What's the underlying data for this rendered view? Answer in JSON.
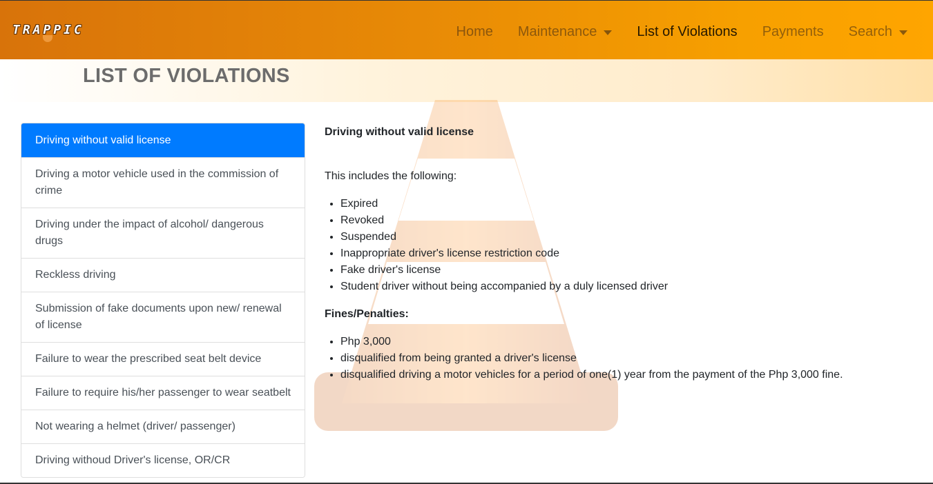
{
  "navbar": {
    "brand": "TRAPPIC",
    "items": [
      {
        "label": "Home",
        "dropdown": false,
        "active": false
      },
      {
        "label": "Maintenance",
        "dropdown": true,
        "active": false
      },
      {
        "label": "List of Violations",
        "dropdown": false,
        "active": true
      },
      {
        "label": "Payments",
        "dropdown": false,
        "active": false
      },
      {
        "label": "Search",
        "dropdown": true,
        "active": false
      }
    ]
  },
  "page": {
    "title": "LIST OF VIOLATIONS"
  },
  "violations": [
    "Driving without valid license",
    "Driving a motor vehicle used in the commission of crime",
    "Driving under the impact of alcohol/ dangerous drugs",
    "Reckless driving",
    "Submission of fake documents upon new/ renewal of license",
    "Failure to wear the prescribed seat belt device",
    "Failure to require his/her passenger to wear seatbelt",
    "Not wearing a helmet (driver/ passenger)",
    "Driving withoud Driver's license, OR/CR"
  ],
  "detail": {
    "title": "Driving without valid license",
    "intro": "This includes the following:",
    "includes": [
      "Expired",
      "Revoked",
      "Suspended",
      "Inappropriate driver's license restriction code",
      "Fake driver's license",
      "Student driver without being accompanied by a duly licensed driver"
    ],
    "penalties_title": "Fines/Penalties:",
    "penalties": [
      "Php 3,000",
      "disqualified from being granted a driver's license",
      "disqualified driving a motor vehicles for a period of one(1) year from the payment of the Php 3,000 fine."
    ]
  },
  "colors": {
    "active_item": "#007bff",
    "navbar_start": "#d8730a",
    "navbar_end": "#ffa500",
    "title_gray": "#6c6c6c"
  }
}
